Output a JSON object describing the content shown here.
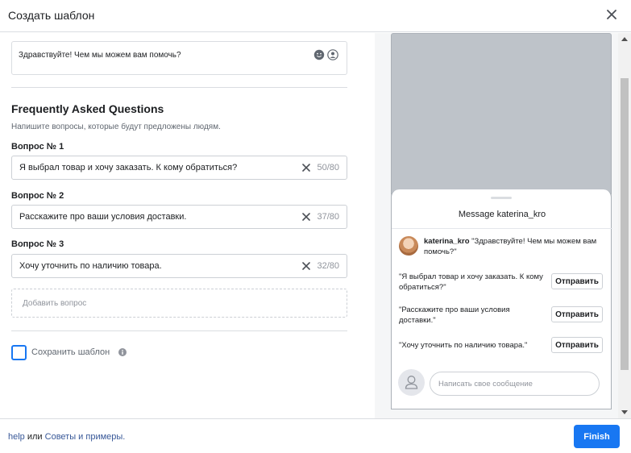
{
  "dialog": {
    "title": "Создать шаблон"
  },
  "greeting": {
    "text": "Здравствуйте! Чем мы можем вам помочь?"
  },
  "faq": {
    "title": "Frequently Asked Questions",
    "subtitle": "Напишите вопросы, которые будут предложены людям.",
    "questions": [
      {
        "label": "Вопрос № 1",
        "value": "Я выбрал товар и хочу заказать. К кому обратиться?",
        "count": "50/80"
      },
      {
        "label": "Вопрос № 2",
        "value": "Расскажите про ваши условия доставки.",
        "count": "37/80"
      },
      {
        "label": "Вопрос № 3",
        "value": "Хочу уточнить по наличию товара.",
        "count": "32/80"
      }
    ],
    "add_question_placeholder": "Добавить вопрос"
  },
  "save_template": {
    "label": "Сохранить шаблон",
    "checked": false
  },
  "preview": {
    "title": "Message katerina_kro",
    "sender": "katerina_kro",
    "greeting": "\"Здравствуйте! Чем мы можем вам помочь?\"",
    "faq_items": [
      {
        "text": "\"Я выбрал товар и хочу заказать. К кому обратиться?\"",
        "button": "Отправить"
      },
      {
        "text": "\"Расскажите про ваши условия доставки.\"",
        "button": "Отправить"
      },
      {
        "text": "\"Хочу уточнить по наличию товара.\"",
        "button": "Отправить"
      }
    ],
    "compose_placeholder": "Написать свое сообщение"
  },
  "footer": {
    "help_link": "help",
    "connector": "или",
    "tips_link": "Советы и примеры."
  },
  "actions": {
    "finish_label": "Finish"
  },
  "colors": {
    "accent": "#1877f2",
    "link": "#385898",
    "preview_bg": "#bec3c9"
  },
  "icons": [
    "close-icon",
    "emoji-icon",
    "person-icon",
    "clear-icon",
    "info-icon",
    "user-placeholder-icon"
  ]
}
